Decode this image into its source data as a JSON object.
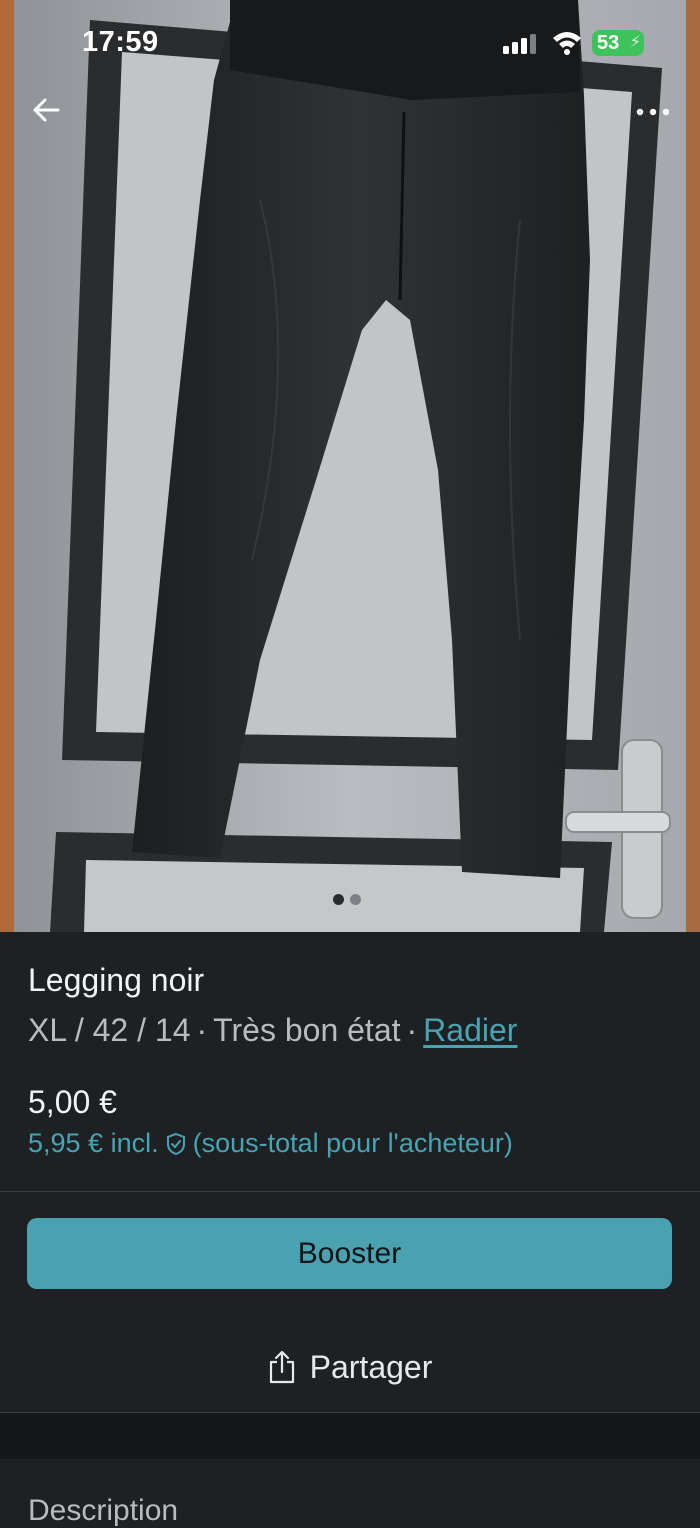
{
  "status_bar": {
    "time": "17:59",
    "battery": "53"
  },
  "header": {
    "back_icon": "arrow-left-icon",
    "more_icon": "more-horizontal-icon"
  },
  "gallery": {
    "image_count": 2,
    "active_index": 0
  },
  "listing": {
    "title": "Legging noir",
    "size": "XL / 42 / 14",
    "separator": "·",
    "condition": "Très bon état",
    "brand_link": "Radier",
    "price": "5,00 €",
    "price_incl": "5,95 € incl.",
    "price_incl_note": "(sous-total pour l'acheteur)"
  },
  "actions": {
    "booster": "Booster",
    "share": "Partager"
  },
  "section": {
    "description_title": "Description"
  },
  "colors": {
    "background": "#1d2124",
    "accent": "#4aa1b0"
  }
}
